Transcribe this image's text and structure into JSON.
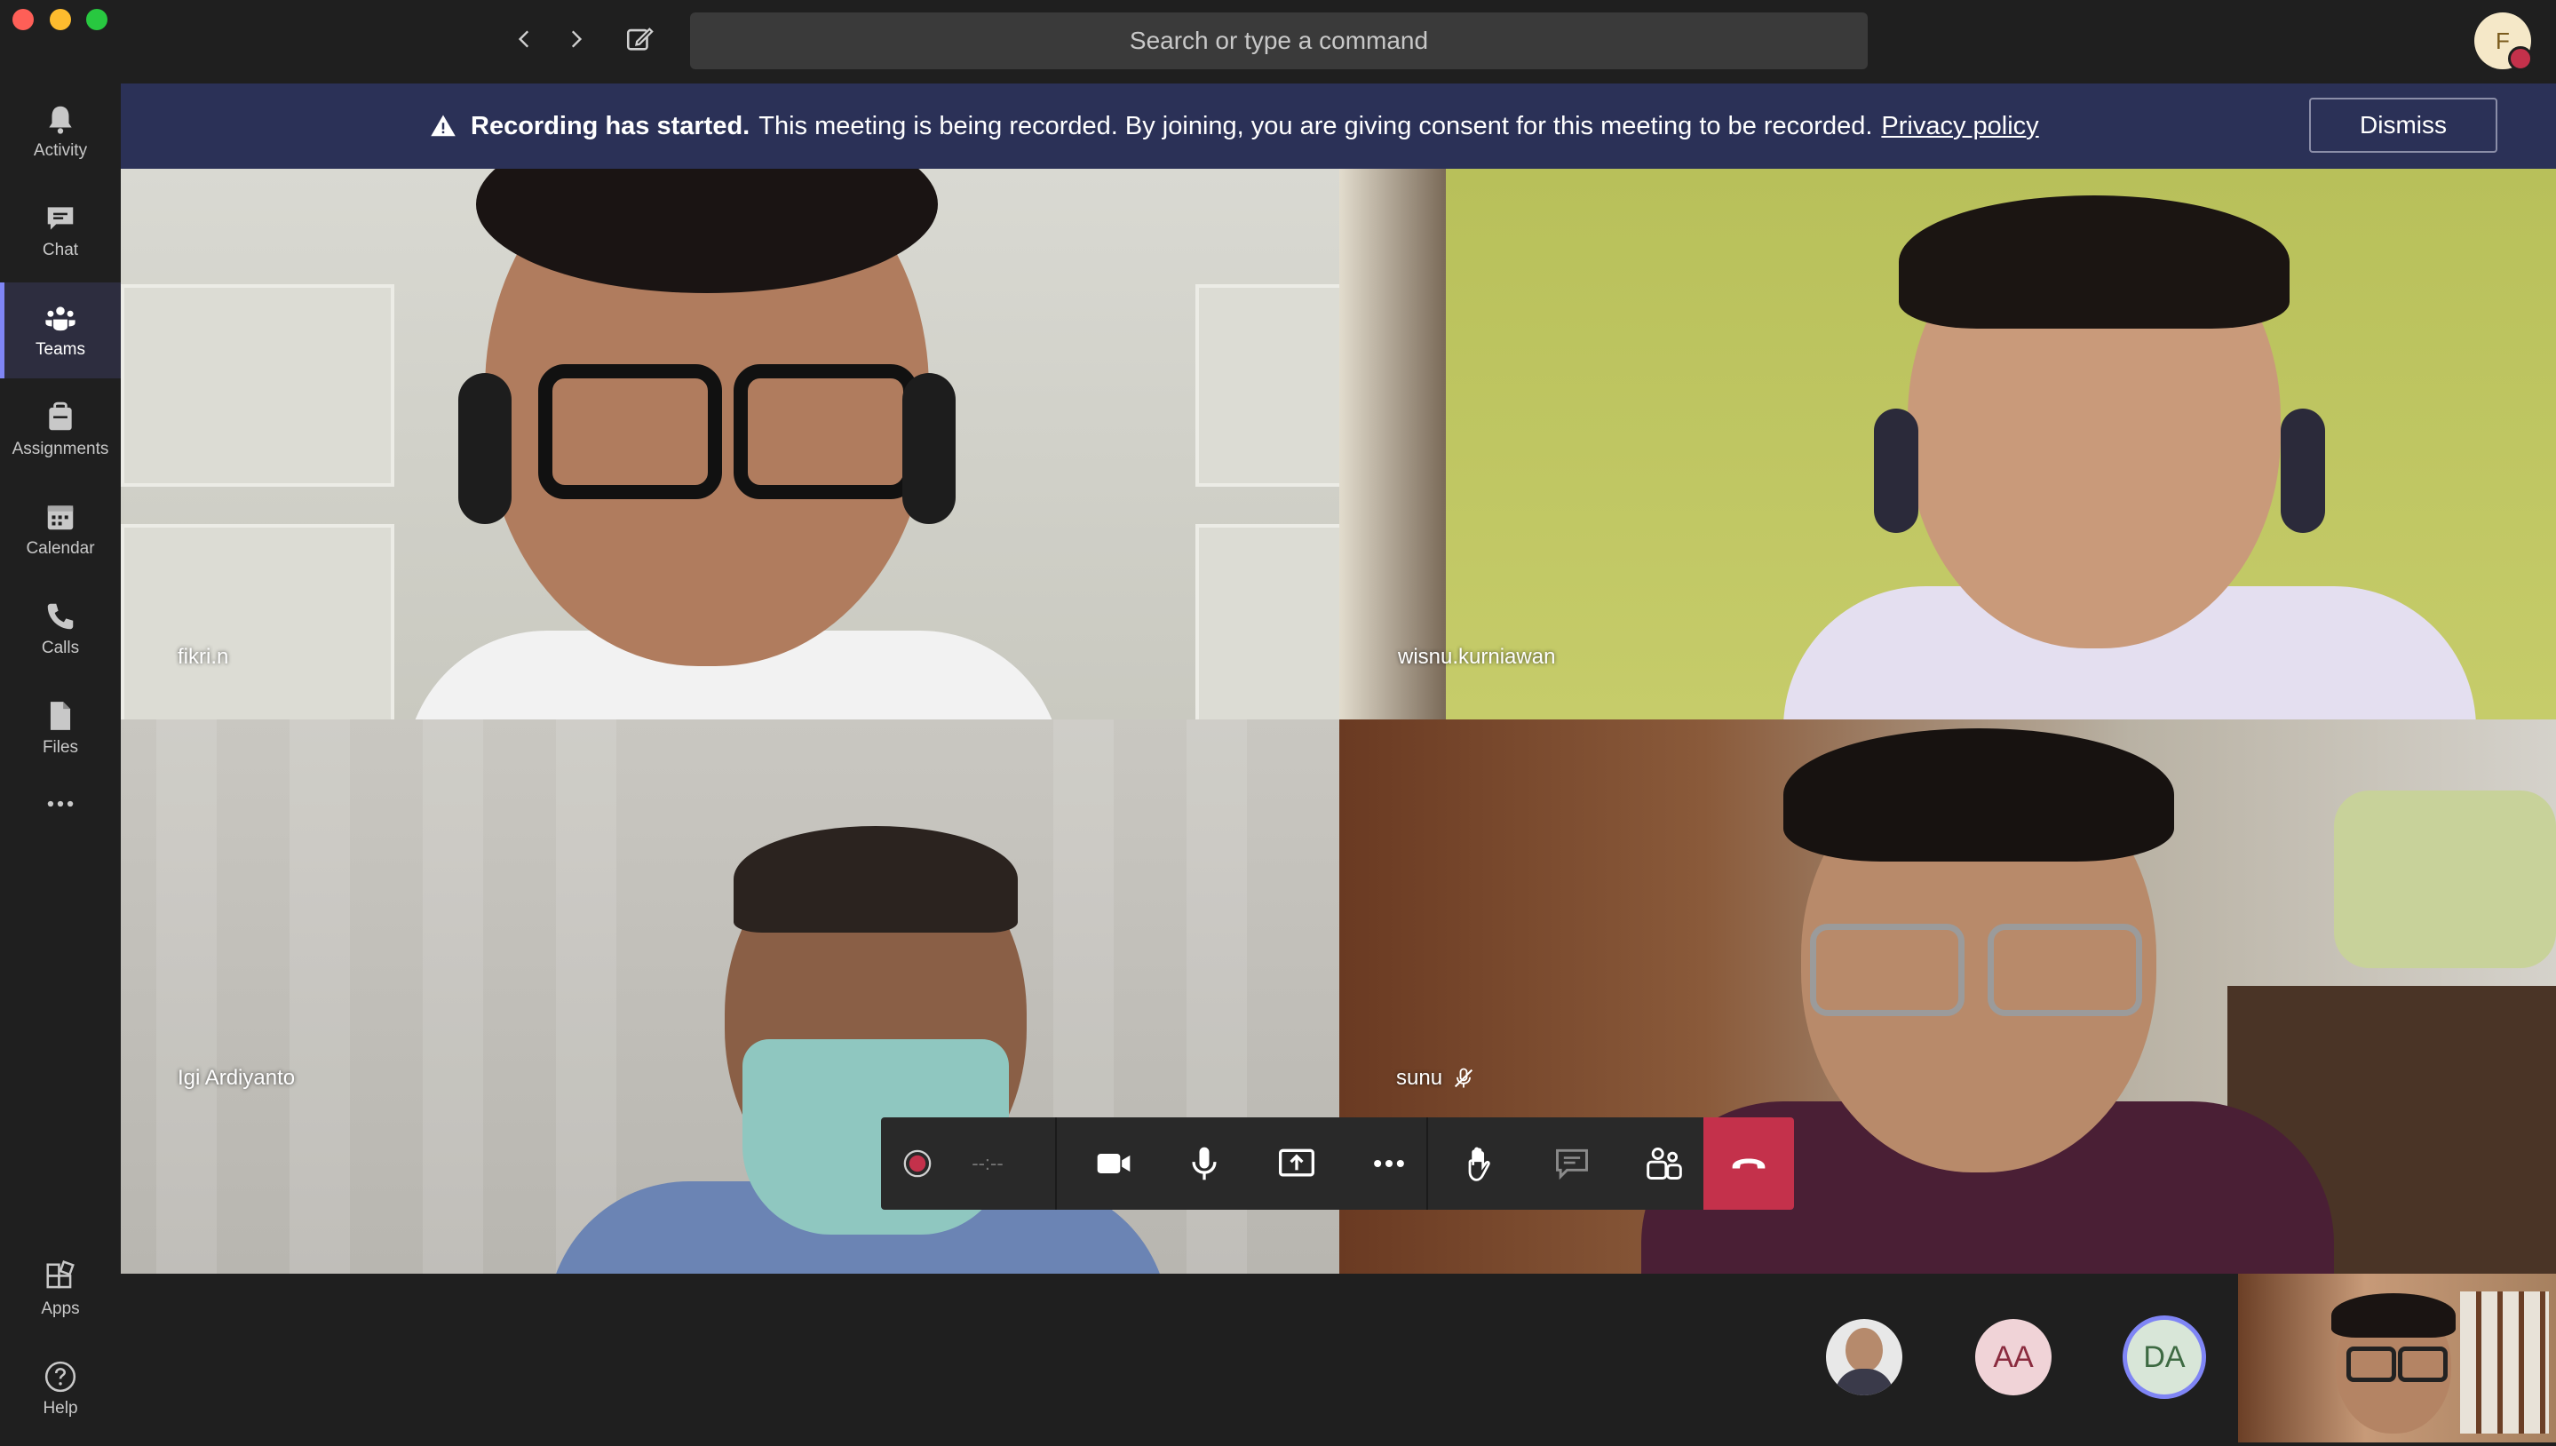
{
  "titlebar": {
    "search_placeholder": "Search or type a command",
    "profile_initial": "F",
    "back_icon": "chevron-left-icon",
    "forward_icon": "chevron-right-icon",
    "compose_icon": "compose-icon"
  },
  "rail": {
    "items": [
      {
        "label": "Activity",
        "icon": "bell-icon"
      },
      {
        "label": "Chat",
        "icon": "chat-icon"
      },
      {
        "label": "Teams",
        "icon": "teams-icon",
        "active": true
      },
      {
        "label": "Assignments",
        "icon": "assignments-icon"
      },
      {
        "label": "Calendar",
        "icon": "calendar-icon"
      },
      {
        "label": "Calls",
        "icon": "phone-icon"
      },
      {
        "label": "Files",
        "icon": "file-icon"
      },
      {
        "label": "Apps",
        "icon": "apps-icon"
      },
      {
        "label": "Help",
        "icon": "help-icon"
      }
    ],
    "more_icon": "more-icon"
  },
  "banner": {
    "title": "Recording has started.",
    "message": "This meeting is being recorded. By joining, you are giving consent for this meeting to be recorded.",
    "link": "Privacy policy",
    "dismiss": "Dismiss",
    "icon": "warning-icon"
  },
  "participants": [
    {
      "name": "fikri.n",
      "muted": false
    },
    {
      "name": "wisnu.kurniawan",
      "muted": false
    },
    {
      "name": "Igi Ardiyanto",
      "muted": false
    },
    {
      "name": "sunu",
      "muted": true
    }
  ],
  "controls": {
    "timer": "--:--",
    "icons": [
      "record-icon",
      "camera-icon",
      "microphone-icon",
      "share-screen-icon",
      "more-icon",
      "raise-hand-icon",
      "chat-icon",
      "participants-icon",
      "hang-up-icon"
    ],
    "hangup_color": "#c4314b"
  },
  "roster": [
    {
      "initials": "",
      "type": "photo"
    },
    {
      "initials": "AA",
      "type": "initials"
    },
    {
      "initials": "DA",
      "type": "initials",
      "speaking": true
    }
  ],
  "colors": {
    "accent": "#7f85f5",
    "banner_bg": "#2b3157",
    "background": "#1f1f1f"
  }
}
